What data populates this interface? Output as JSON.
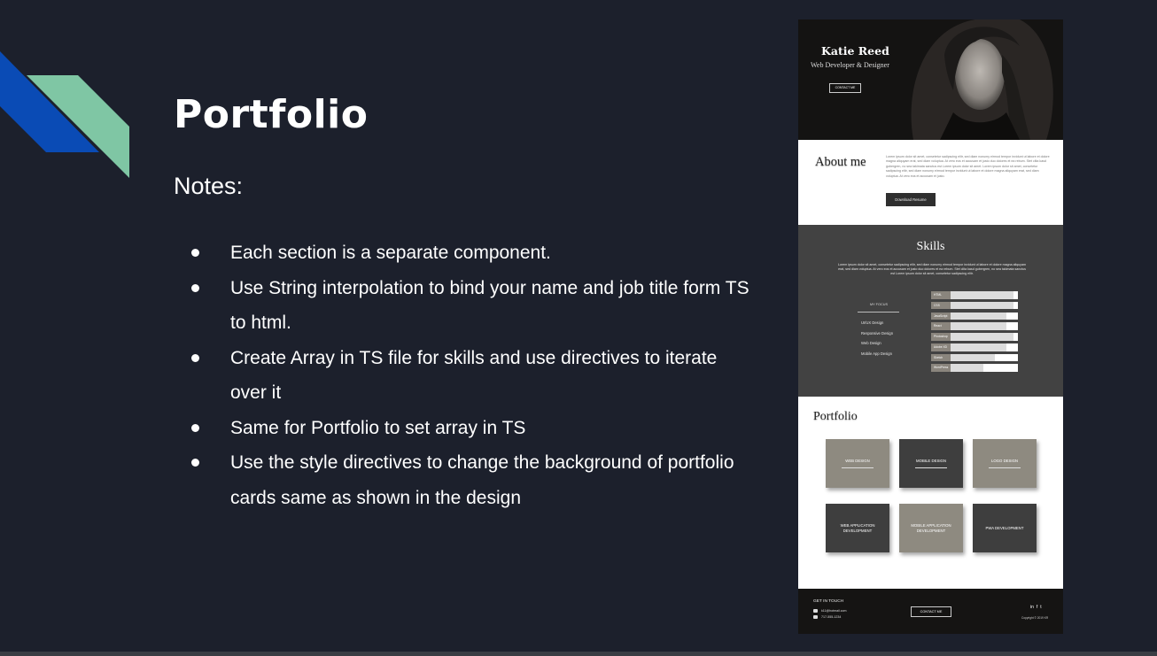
{
  "slide": {
    "title": "Portfolio",
    "notes_heading": "Notes:",
    "bullets": [
      "Each section is a separate component.",
      "Use String interpolation to bind your name and job title form TS to html.",
      "Create Array in TS file for skills and use directives to iterate over it",
      "Same for Portfolio to set array in TS",
      "Use the style directives to change the background of portfolio cards same as shown in the design"
    ],
    "colors": {
      "background": "#1c202c",
      "deco_blue": "#0a4bb5",
      "deco_green": "#7fc6a4"
    }
  },
  "mockup": {
    "hero": {
      "name": "Katie Reed",
      "job": "Web Developer & Designer",
      "button": "CONTACT ME"
    },
    "about": {
      "heading": "About me",
      "text": "Lorem ipsum dolor sit amet, consetetur sadipscing elitr, sed diam nonumy eirmod tempor invidunt ut labore et dolore magna aliquyam erat, sed diam voluptua. At vero eos et accusam et justo duo dolores et ea rebum. Stet clita kasd gubergren, no sea takimata sanctus est Lorem ipsum dolor sit amet. Lorem ipsum dolor sit amet, consetetur sadipscing elitr, sed diam nonumy eirmod tempor invidunt ut labore et dolore magna aliquyam erat, sed diam voluptua. At vero eos et accusam et justo.",
      "button": "Download Resume"
    },
    "skills": {
      "heading": "Skills",
      "text": "Lorem ipsum dolor sit amet, consetetur sadipscing elitr, sed diam nonumy eirmod tempor invidunt ut labore et dolore magna aliquyam erat, sed diam voluptua. At vero eos et accusam et justo duo dolores et ea rebum. Stet clita kasd gubergren, no sea takimata sanctus est Lorem ipsum dolor sit amet, consetetur sadipscing elitr.",
      "focus_heading": "MY FOCUS",
      "focus": [
        "UI/UX Design",
        "Responsive Design",
        "Web Design",
        "Mobile App Design"
      ],
      "bars": [
        {
          "label": "HTML",
          "level": 0.95
        },
        {
          "label": "CSS",
          "level": 0.95
        },
        {
          "label": "JavaScript",
          "level": 0.87
        },
        {
          "label": "React",
          "level": 0.87
        },
        {
          "label": "Photoshop",
          "level": 0.95
        },
        {
          "label": "Adobe XD",
          "level": 0.87
        },
        {
          "label": "Sketch",
          "level": 0.73
        },
        {
          "label": "WordPress",
          "level": 0.6
        }
      ]
    },
    "portfolio": {
      "heading": "Portfolio",
      "cards": [
        {
          "label": "WEB DESIGN",
          "tone": "gray",
          "underline": true
        },
        {
          "label": "MOBILE DESIGN",
          "tone": "dark",
          "underline": true
        },
        {
          "label": "LOGO DESIGN",
          "tone": "gray",
          "underline": true
        },
        {
          "label": "WEB APPLICATION DEVELOPMENT",
          "tone": "dark",
          "underline": false
        },
        {
          "label": "MOBILE APPLICATION DEVELOPMENT",
          "tone": "gray",
          "underline": false
        },
        {
          "label": "PWA DEVELOPMENT",
          "tone": "dark",
          "underline": false
        }
      ]
    },
    "footer": {
      "heading": "GET IN TOUCH",
      "email": "k11@hotmail.com",
      "phone": "717-555-1234",
      "button": "CONTACT ME",
      "socials": [
        "in",
        "f",
        "t"
      ],
      "copyright": "Copyright © 2019 KR"
    }
  }
}
